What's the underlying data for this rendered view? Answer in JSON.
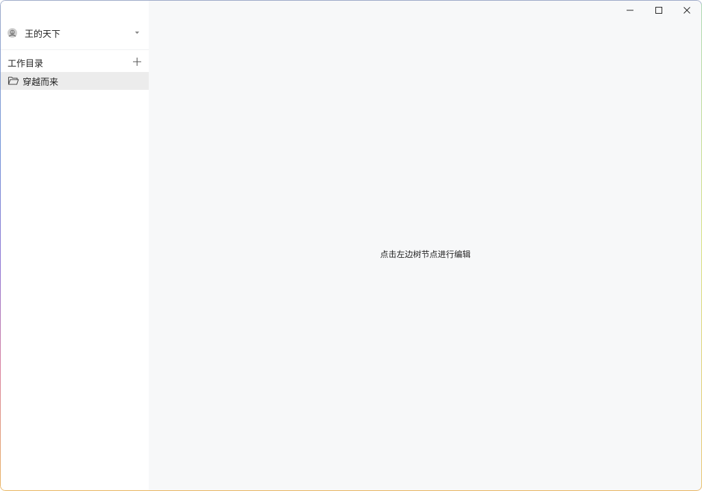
{
  "account": {
    "name": "王的天下",
    "avatar_icon": "avatar-icon"
  },
  "sidebar": {
    "section_title": "工作目录",
    "add_icon": "plus-icon",
    "items": [
      {
        "label": "穿越而来",
        "icon": "folder-open-icon",
        "selected": true
      }
    ]
  },
  "main": {
    "hint": "点击左边树节点进行编辑"
  },
  "window_controls": {
    "minimize_icon": "minimize-icon",
    "maximize_icon": "maximize-icon",
    "close_icon": "close-icon"
  }
}
